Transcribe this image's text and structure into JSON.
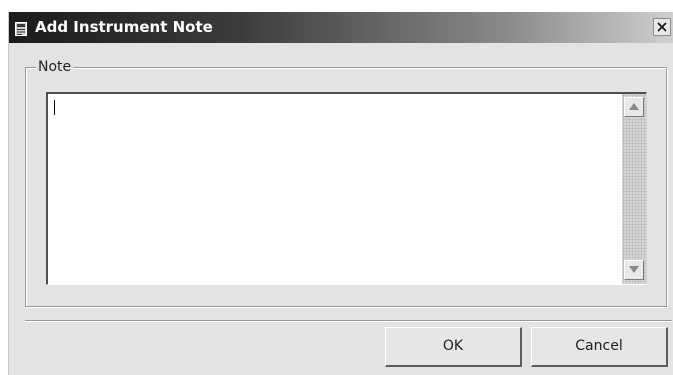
{
  "window": {
    "title": "Add Instrument Note",
    "app_icon": "app-window-icon",
    "close_icon": "close-icon"
  },
  "note_group": {
    "legend": "Note",
    "input": {
      "value": "",
      "placeholder": ""
    },
    "scrollbar": {
      "up_icon": "arrow-up-icon",
      "down_icon": "arrow-down-icon"
    }
  },
  "buttons": {
    "ok_label": "OK",
    "cancel_label": "Cancel"
  },
  "colors": {
    "titlebar_start": "#1b1b1b",
    "titlebar_end": "#cfcfcf",
    "dialog_background": "#e3e3e3"
  }
}
